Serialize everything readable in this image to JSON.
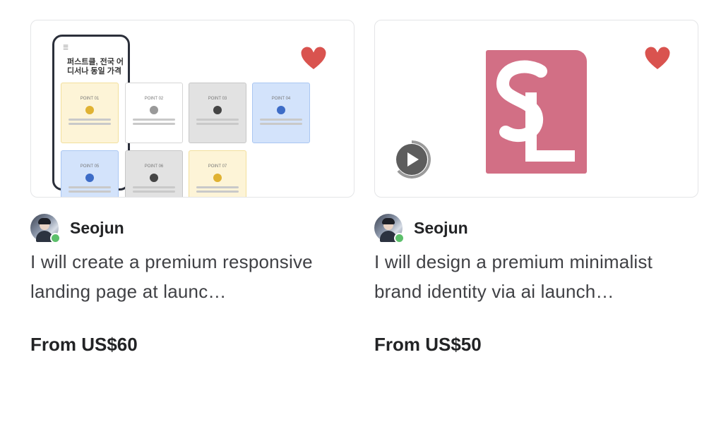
{
  "colors": {
    "heart": "#d9534f",
    "online": "#5cbf6b",
    "logo_bg": "#d26f85",
    "text_dark": "#222325",
    "text_muted": "#404145"
  },
  "gigs": [
    {
      "seller": "Seojun",
      "title": "I will create a premium responsive landing page at launc…",
      "price": "From US$60",
      "thumbnail": {
        "phone_text": "퍼스트클, 전국 어디서나 동일 가격",
        "tiles": [
          "POINT 01",
          "POINT 02",
          "POINT 03",
          "POINT 04",
          "POINT 05",
          "POINT 06",
          "POINT 07"
        ]
      }
    },
    {
      "seller": "Seojun",
      "title": "I will design a premium minimalist brand identity via ai launch…",
      "price": "From US$50",
      "thumbnail": {
        "logo": "SL"
      }
    }
  ]
}
